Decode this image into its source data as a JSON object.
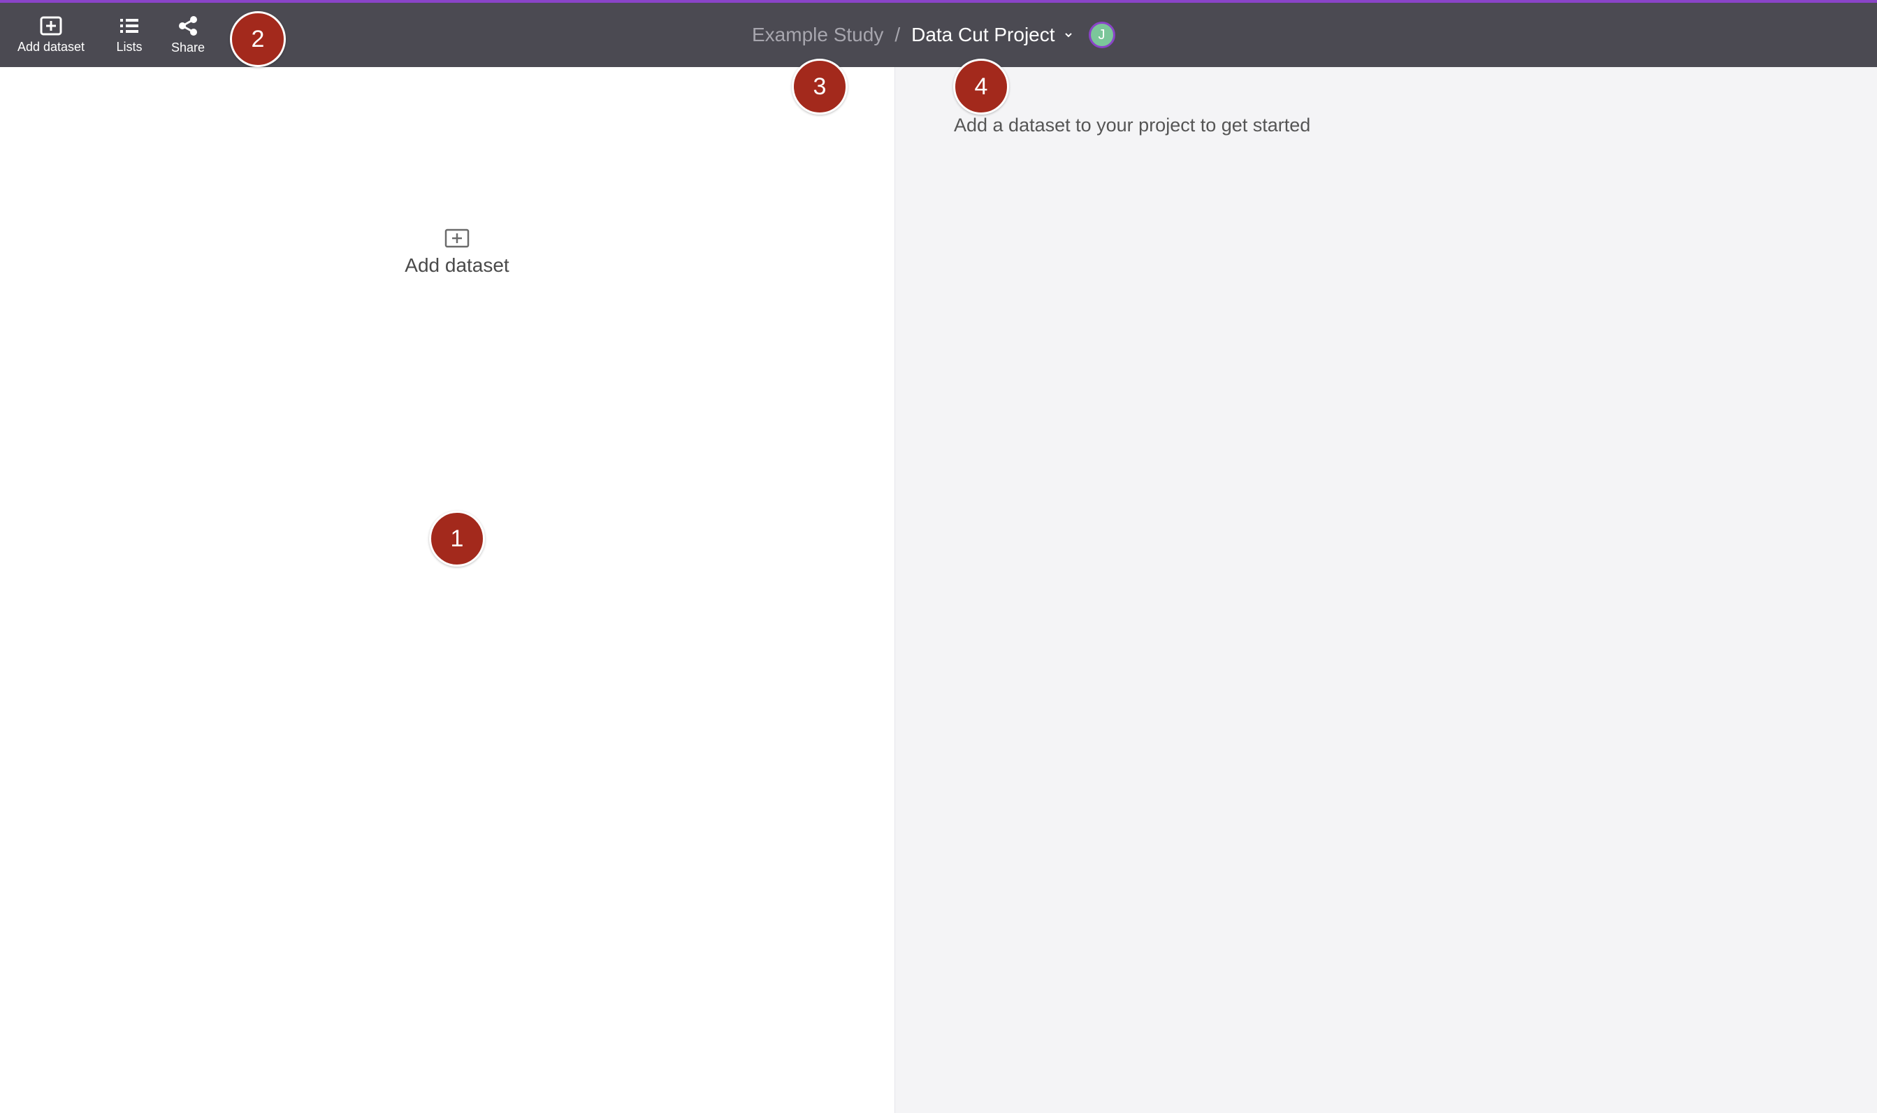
{
  "toolbar": {
    "add_dataset_label": "Add dataset",
    "lists_label": "Lists",
    "share_label": "Share"
  },
  "breadcrumb": {
    "study": "Example Study",
    "separator": "/",
    "project": "Data Cut Project"
  },
  "user": {
    "avatar_initial": "J"
  },
  "left_panel": {
    "add_dataset_label": "Add dataset"
  },
  "right_panel": {
    "empty_message": "Add a dataset to your project to get started"
  },
  "markers": [
    "1",
    "2",
    "3",
    "4"
  ],
  "colors": {
    "topbar": "#4b4a52",
    "accent": "#8a44c8",
    "marker": "#a3291c",
    "avatar": "#7bc69a",
    "right_panel_bg": "#f4f4f6"
  },
  "icons": {
    "add_dataset": "add-box-icon",
    "lists": "list-icon",
    "share": "share-icon",
    "dropdown": "chevron-down-icon"
  }
}
